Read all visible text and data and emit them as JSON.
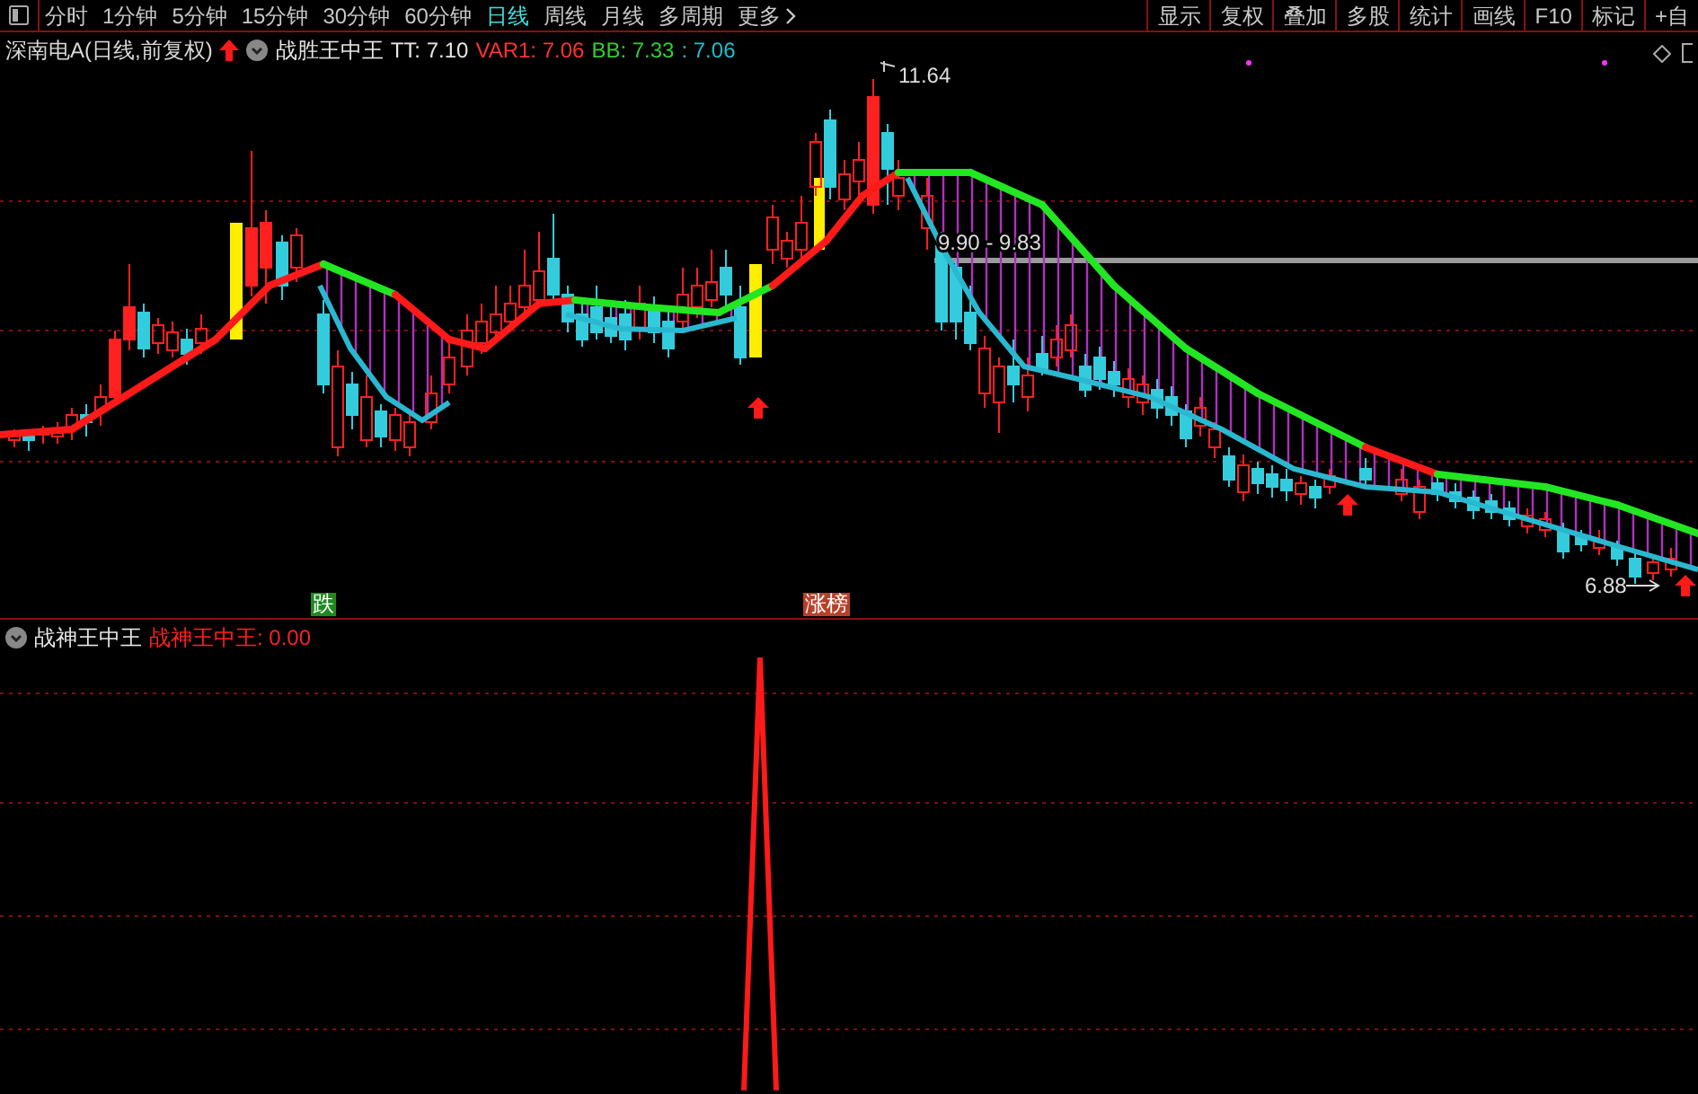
{
  "toolbar": {
    "periods": [
      {
        "label": "分时",
        "selected": false
      },
      {
        "label": "1分钟",
        "selected": false
      },
      {
        "label": "5分钟",
        "selected": false
      },
      {
        "label": "15分钟",
        "selected": false
      },
      {
        "label": "30分钟",
        "selected": false
      },
      {
        "label": "60分钟",
        "selected": false
      },
      {
        "label": "日线",
        "selected": true
      },
      {
        "label": "周线",
        "selected": false
      },
      {
        "label": "月线",
        "selected": false
      },
      {
        "label": "多周期",
        "selected": false
      },
      {
        "label": "更多",
        "selected": false
      }
    ],
    "buttons": [
      "显示",
      "复权",
      "叠加",
      "多股",
      "统计",
      "画线",
      "F10",
      "标记",
      "+自"
    ]
  },
  "main_pane": {
    "title": "深南电A(日线,前复权)",
    "indicator": "战胜王中王",
    "values": [
      {
        "text": "TT: 7.10",
        "color": "#e6e6e6"
      },
      {
        "text": "VAR1: 7.06",
        "color": "#ff3232"
      },
      {
        "text": "BB: 7.33",
        "color": "#33cc33"
      },
      {
        "text": ": 7.06",
        "color": "#22bbcc"
      }
    ],
    "annotations": {
      "high": "11.64",
      "range": "9.90 - 9.83",
      "low": "6.88"
    },
    "signal_labels": [
      {
        "text": "跌",
        "color": "#1f8a1f"
      },
      {
        "text": "涨榜",
        "color": "#b8402a"
      }
    ]
  },
  "lower_pane": {
    "indicator": "战神王中王",
    "value": "战神王中王: 0.00"
  }
}
